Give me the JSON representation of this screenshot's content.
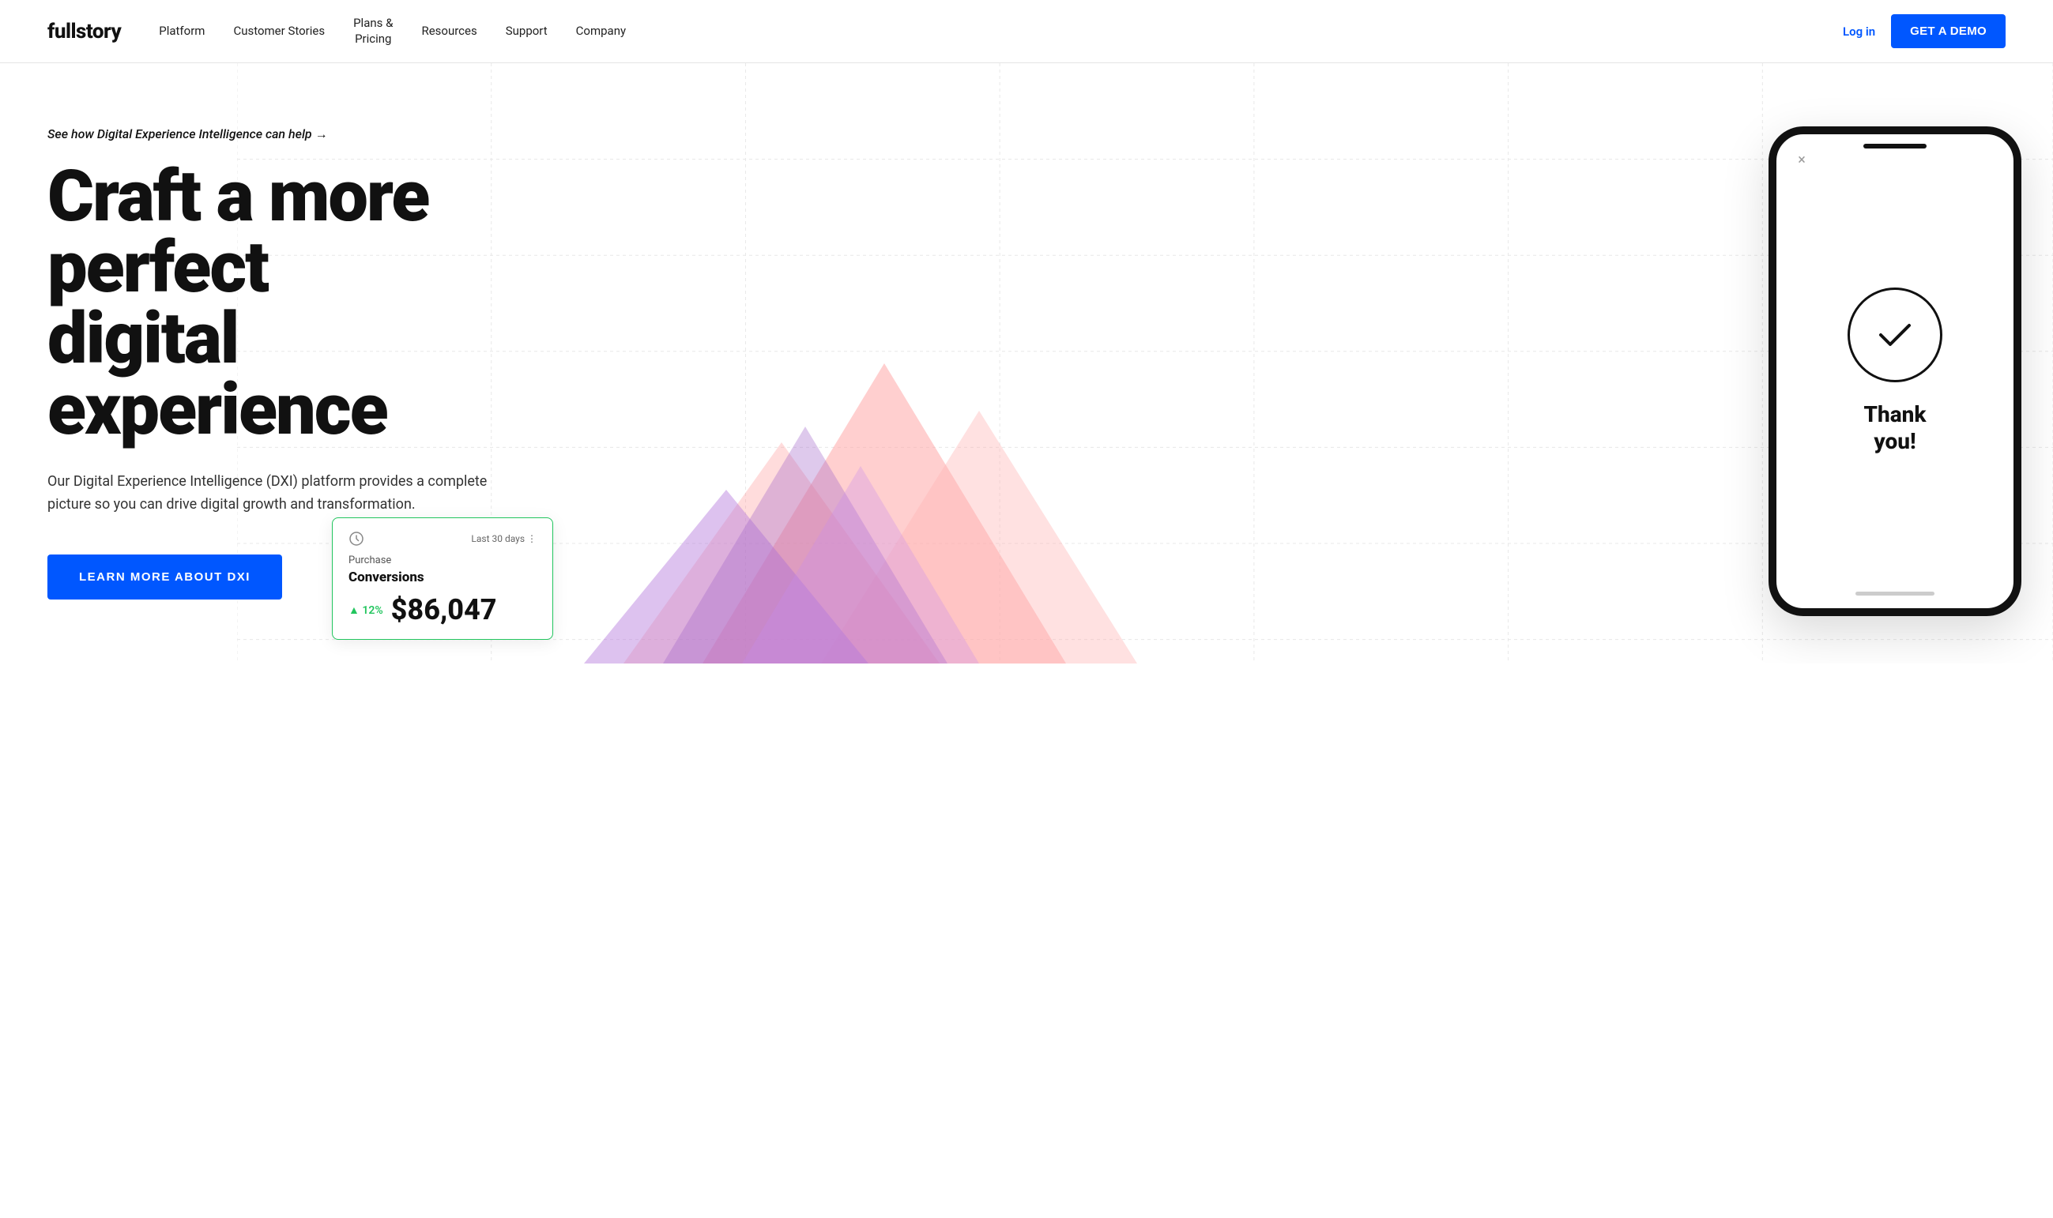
{
  "header": {
    "logo": "fullstory",
    "nav": [
      {
        "id": "platform",
        "label": "Platform"
      },
      {
        "id": "customer-stories",
        "label": "Customer Stories"
      },
      {
        "id": "plans-pricing",
        "label": "Plans &\nPricing"
      },
      {
        "id": "resources",
        "label": "Resources"
      },
      {
        "id": "support",
        "label": "Support"
      },
      {
        "id": "company",
        "label": "Company"
      }
    ],
    "login_label": "Log in",
    "demo_label": "GET A DEMO"
  },
  "hero": {
    "eyebrow": "See how Digital Experience Intelligence can help →",
    "title_line1": "Craft a more perfect",
    "title_line2": "digital experience",
    "description": "Our Digital Experience Intelligence (DXI) platform provides a complete picture so you can drive digital growth and transformation.",
    "cta_label": "LEARN MORE ABOUT DXI",
    "phone": {
      "close_icon": "×",
      "thank_you": "Thank\nyou!"
    },
    "stats_card": {
      "period": "Last 30 days ⋮",
      "label": "Purchase",
      "title": "Conversions",
      "change": "▲ 12%",
      "value": "$86,047"
    }
  }
}
